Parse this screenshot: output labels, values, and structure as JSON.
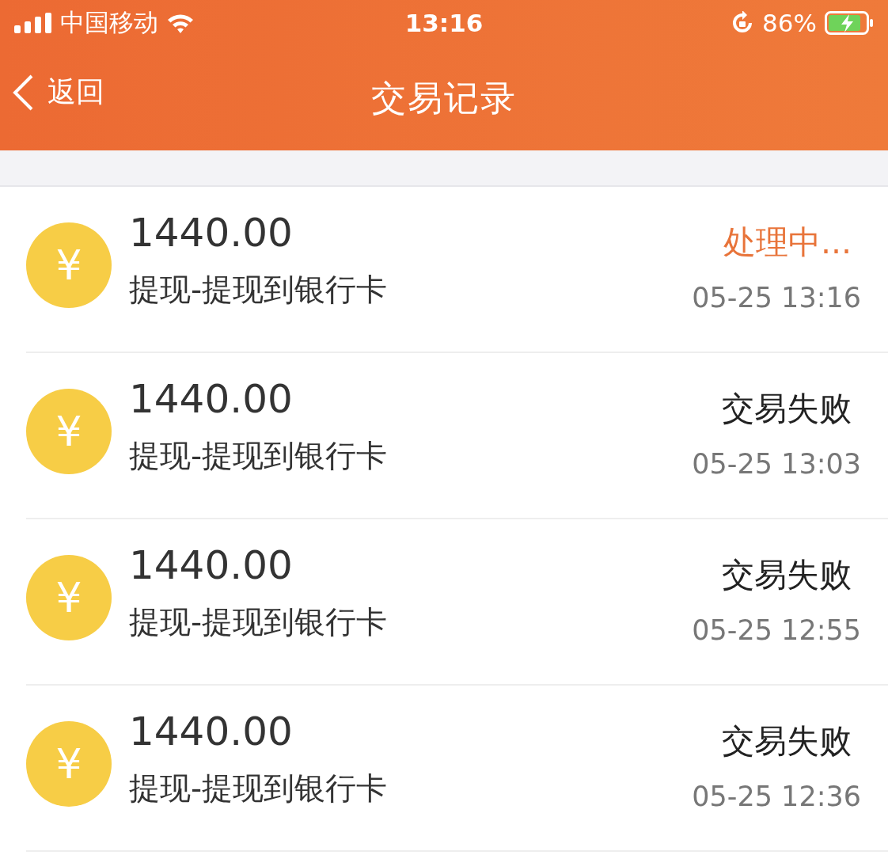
{
  "status_bar": {
    "carrier": "中国移动",
    "time": "13:16",
    "battery": "86%"
  },
  "nav": {
    "back": "返回",
    "title": "交易记录"
  },
  "transactions": [
    {
      "icon": "¥",
      "amount": "1440.00",
      "description": "提现-提现到银行卡",
      "status": "处理中...",
      "kind": "processing",
      "time": "05-25 13:16"
    },
    {
      "icon": "¥",
      "amount": "1440.00",
      "description": "提现-提现到银行卡",
      "status": "交易失败",
      "kind": "failed",
      "time": "05-25 13:03"
    },
    {
      "icon": "¥",
      "amount": "1440.00",
      "description": "提现-提现到银行卡",
      "status": "交易失败",
      "kind": "failed",
      "time": "05-25 12:55"
    },
    {
      "icon": "¥",
      "amount": "1440.00",
      "description": "提现-提现到银行卡",
      "status": "交易失败",
      "kind": "failed",
      "time": "05-25 12:36"
    }
  ]
}
